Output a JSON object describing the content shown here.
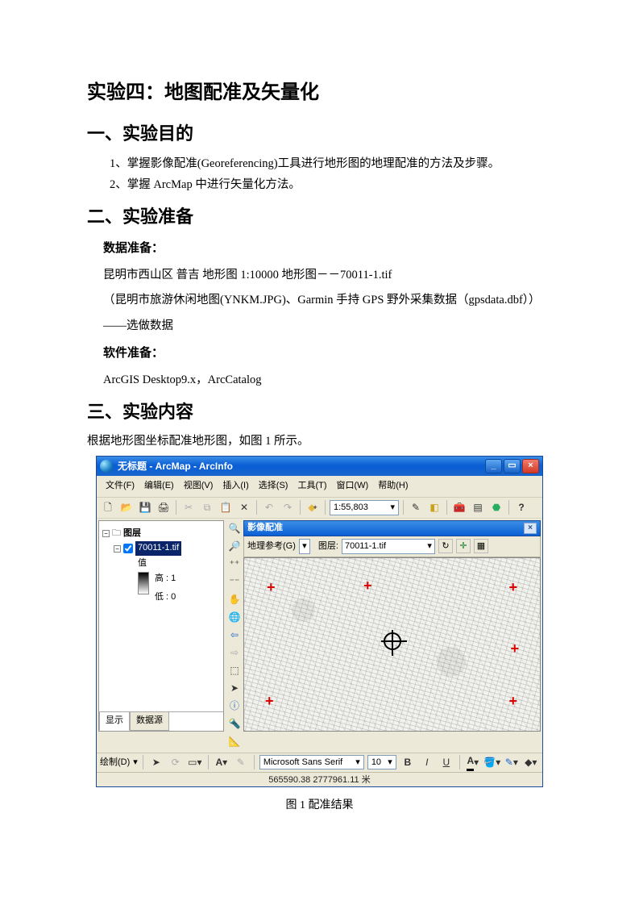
{
  "doc": {
    "title": "实验四：地图配准及矢量化",
    "section1": "一、实验目的",
    "bullet1": "1、掌握影像配准(Georeferencing)工具进行地形图的地理配准的方法及步骤。",
    "bullet2": "2、掌握 ArcMap 中进行矢量化方法。",
    "section2": "二、实验准备",
    "data_prep_label": "数据准备：",
    "data_line1": "昆明市西山区  普吉  地形图  1:10000  地形图－－70011-1.tif",
    "data_line2": "（昆明市旅游休闲地图(YNKM.JPG)、Garmin  手持 GPS 野外采集数据（gpsdata.dbf））",
    "data_line3": "——选做数据",
    "soft_prep_label": "软件准备：",
    "soft_line": "ArcGIS Desktop9.x，ArcCatalog",
    "section3": "三、实验内容",
    "content_line": "根据地形图坐标配准地形图，如图 1 所示。",
    "fig_caption": "图 1 配准结果"
  },
  "arcmap": {
    "title": "无标题 - ArcMap - ArcInfo",
    "menus": {
      "file": "文件(F)",
      "edit": "编辑(E)",
      "view": "视图(V)",
      "insert": "插入(I)",
      "select": "选择(S)",
      "tools": "工具(T)",
      "window": "窗口(W)",
      "help": "帮助(H)"
    },
    "scale": "1:55,803",
    "toc": {
      "root": "图层",
      "layer": "70011-1.tif",
      "value_label": "值",
      "high": "高 : 1",
      "low": "低 : 0",
      "tab_display": "显示",
      "tab_source": "数据源"
    },
    "georef": {
      "title": "影像配准",
      "ref_label": "地理参考(G)",
      "layer_label": "图层:",
      "layer_value": "70011-1.tif"
    },
    "draw": {
      "label": "绘制(D)",
      "font": "Microsoft Sans Serif",
      "size": "10"
    },
    "status": "565590.38 2777961.11 米"
  }
}
